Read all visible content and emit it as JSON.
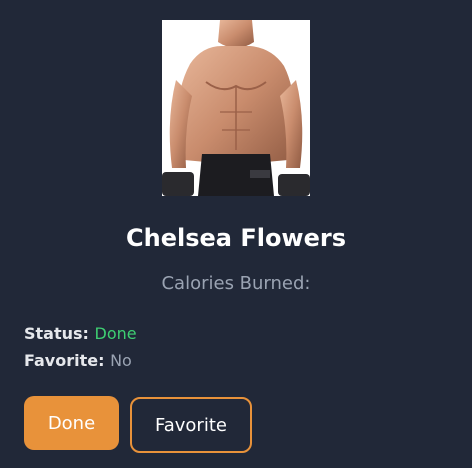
{
  "card": {
    "image_alt": "Athletic man holding dumbbells",
    "name": "Chelsea Flowers",
    "subtitle": "Calories Burned:"
  },
  "meta": {
    "status_label": "Status:",
    "status_value": "Done",
    "favorite_label": "Favorite:",
    "favorite_value": "No"
  },
  "buttons": {
    "done_label": "Done",
    "favorite_label": "Favorite"
  },
  "colors": {
    "background": "#212838",
    "accent": "#e8923a",
    "status_done": "#3ecf72",
    "muted_text": "#9aa3b2"
  }
}
